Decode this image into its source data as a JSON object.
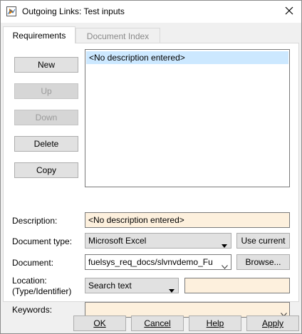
{
  "window": {
    "title": "Outgoing Links: Test inputs"
  },
  "tabs": [
    {
      "label": "Requirements",
      "active": true
    },
    {
      "label": "Document Index",
      "active": false
    }
  ],
  "side_buttons": {
    "new": "New",
    "up": "Up",
    "down": "Down",
    "delete": "Delete",
    "copy": "Copy"
  },
  "requirements_list": {
    "items": [
      "<No description entered>"
    ],
    "selected_index": 0
  },
  "form": {
    "description_label": "Description:",
    "description_value": "<No description entered>",
    "doc_type_label": "Document type:",
    "doc_type_value": "Microsoft Excel",
    "use_current_label": "Use current",
    "document_label": "Document:",
    "document_value": "fuelsys_req_docs/slvnvdemo_Fu",
    "browse_label": "Browse...",
    "location_label_line1": "Location:",
    "location_label_line2": "(Type/Identifier)",
    "location_type_value": "Search text",
    "location_identifier_value": "",
    "keywords_label": "Keywords:",
    "keywords_value": ""
  },
  "footer": {
    "ok": "OK",
    "cancel": "Cancel",
    "help": "Help",
    "apply": "Apply"
  },
  "colors": {
    "editable_field_bg": "#fdf0dd",
    "selection_bg": "#cce8ff",
    "button_bg": "#e1e1e1"
  },
  "icons": {
    "app": "simulink-window-icon",
    "close": "close-icon",
    "dropdown": "chevron-down-icon"
  }
}
